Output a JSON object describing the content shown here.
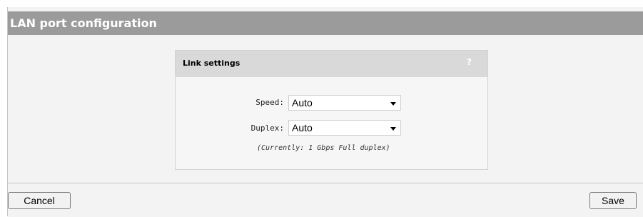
{
  "page": {
    "title": "LAN port configuration"
  },
  "panel": {
    "title": "Link settings",
    "help_icon": "?",
    "speed": {
      "label": "Speed:",
      "value": "Auto"
    },
    "duplex": {
      "label": "Duplex:",
      "value": "Auto"
    },
    "status_note": "(Currently: 1 Gbps Full duplex)"
  },
  "footer": {
    "cancel_label": "Cancel",
    "save_label": "Save"
  },
  "colors": {
    "title_bar": "#9b9b9b",
    "panel_header": "#d9d9d9",
    "background": "#f3f3f3"
  }
}
